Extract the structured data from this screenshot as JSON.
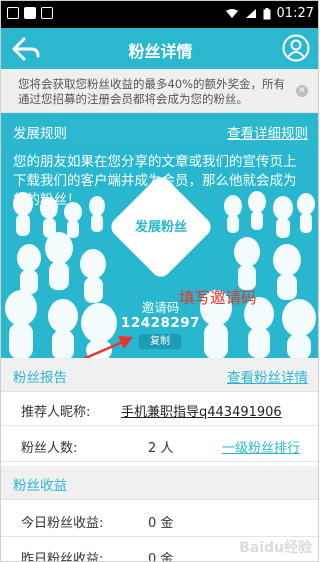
{
  "status_bar": {
    "time": "01:27"
  },
  "header": {
    "title": "粉丝详情"
  },
  "notice": {
    "text": "您将会获取您粉丝收益的最多40%的额外奖金，所有通过您招募的注册会员都将会成为您的粉丝。"
  },
  "rules": {
    "title": "发展规则",
    "detail_link": "查看详细规则"
  },
  "banner": {
    "description": "您的朋友如果在您分享的文章或我们的宣传页上下载我们的客户端并成为会员，那么他就会成为您的粉丝！",
    "develop_button": "发展粉丝",
    "invite_label": "邀请码",
    "invite_code": "12428297",
    "copy_button": "复制",
    "annotation": "填写邀请码"
  },
  "report": {
    "title": "粉丝报告",
    "link": "查看粉丝详情"
  },
  "report_rows": {
    "referrer_label": "推荐人昵称:",
    "referrer_value": "手机兼职指导q443491906",
    "count_label": "粉丝人数:",
    "count_value": "2 人",
    "ranking_link": "一级粉丝排行"
  },
  "income": {
    "title": "粉丝收益"
  },
  "income_rows": {
    "today_label": "今日粉丝收益:",
    "today_value": "0 金",
    "yesterday_label": "昨日粉丝收益:",
    "yesterday_value": "0 金"
  },
  "watermark": "Baidu经验",
  "colors": {
    "accent": "#2bb8cf",
    "annotation": "#e8362c"
  }
}
